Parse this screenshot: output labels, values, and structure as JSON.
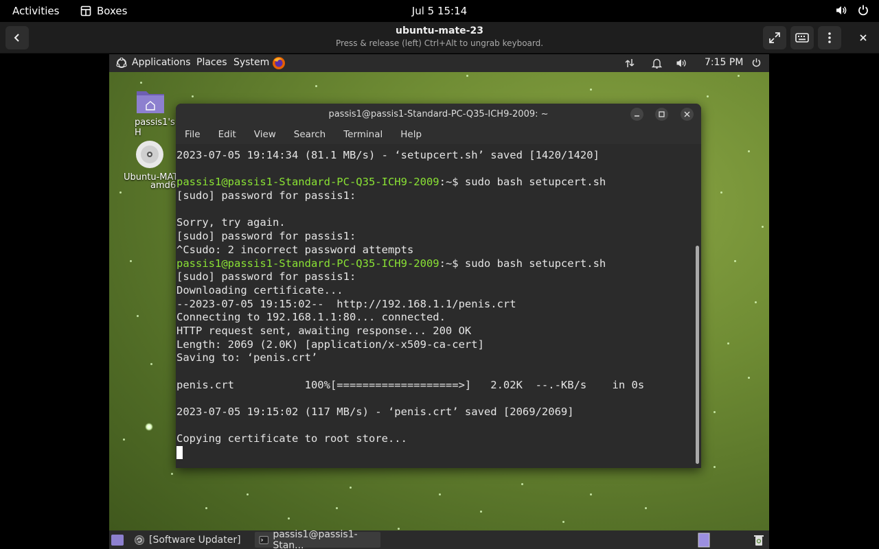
{
  "gnome_bar": {
    "activities": "Activities",
    "app_name": "Boxes",
    "clock": "Jul 5  15:14"
  },
  "boxes_header": {
    "title": "ubuntu-mate-23",
    "subtitle": "Press & release (left) Ctrl+Alt to ungrab keyboard."
  },
  "mate_panel": {
    "applications": "Applications",
    "places": "Places",
    "system": "System",
    "time": "7:15 PM"
  },
  "desktop_icons": {
    "home_label": "passis1's H",
    "disc_label_1": "Ubuntu-MAT",
    "disc_label_2": "amd6"
  },
  "terminal": {
    "title": "passis1@passis1-Standard-PC-Q35-ICH9-2009: ~",
    "menu": [
      "File",
      "Edit",
      "View",
      "Search",
      "Terminal",
      "Help"
    ],
    "lines": [
      {
        "text": "2023-07-05 19:14:34 (81.1 MB/s) - ‘setupcert.sh’ saved [1420/1420]"
      },
      {
        "text": ""
      },
      {
        "user": "passis1@passis1-Standard-PC-Q35-ICH9-2009",
        "text": ":~$ sudo bash setupcert.sh"
      },
      {
        "text": "[sudo] password for passis1:"
      },
      {
        "text": ""
      },
      {
        "text": "Sorry, try again."
      },
      {
        "text": "[sudo] password for passis1:"
      },
      {
        "text": "^Csudo: 2 incorrect password attempts"
      },
      {
        "user": "passis1@passis1-Standard-PC-Q35-ICH9-2009",
        "text": ":~$ sudo bash setupcert.sh"
      },
      {
        "text": "[sudo] password for passis1:"
      },
      {
        "text": "Downloading certificate..."
      },
      {
        "text": "--2023-07-05 19:15:02--  http://192.168.1.1/penis.crt"
      },
      {
        "text": "Connecting to 192.168.1.1:80... connected."
      },
      {
        "text": "HTTP request sent, awaiting response... 200 OK"
      },
      {
        "text": "Length: 2069 (2.0K) [application/x-x509-ca-cert]"
      },
      {
        "text": "Saving to: ‘penis.crt’"
      },
      {
        "text": ""
      },
      {
        "text": "penis.crt           100%[===================>]   2.02K  --.-KB/s    in 0s"
      },
      {
        "text": ""
      },
      {
        "text": "2023-07-05 19:15:02 (117 MB/s) - ‘penis.crt’ saved [2069/2069]"
      },
      {
        "text": ""
      },
      {
        "text": "Copying certificate to root store..."
      }
    ]
  },
  "taskbar": {
    "software_updater": "[Software Updater]",
    "terminal_task": "passis1@passis1-Stan..."
  }
}
